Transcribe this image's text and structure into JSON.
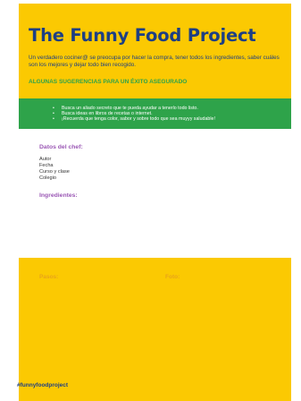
{
  "header": {
    "title": "The Funny Food Project",
    "intro": "Un verdadero cociner@ se preocupa por hacer la compra, tener todos los ingredientes, saber cuáles son los mejores y dejar todo bien recogido."
  },
  "tips": {
    "heading": "ALGUNAS SUGERENCIAS PARA UN ÉXITO ASEGURADO",
    "items": [
      "Busca un aliado secreto que te pueda ayudar a tenerlo todo listo.",
      "Busca ideas en libros de recetas o internet.",
      "¡Recuerda que tenga color, sabor y sobre todo que sea muyyy saludable!"
    ]
  },
  "chef": {
    "heading": "Datos del chef:",
    "fields": [
      "Autor",
      "Fecha",
      "Curso y clase",
      "Colegio"
    ]
  },
  "ingredients": {
    "heading": "Ingredientes:"
  },
  "steps": {
    "heading": "Pasos:"
  },
  "photo": {
    "heading": "Foto:"
  },
  "footer": {
    "hashtag": "#funnyfoodproject"
  },
  "colors": {
    "page_background": "#fbc902",
    "title": "#1d3f84",
    "tips_band": "#2ea34a",
    "section_label": "#9b58b5",
    "bottom_label": "#e8a41a"
  }
}
